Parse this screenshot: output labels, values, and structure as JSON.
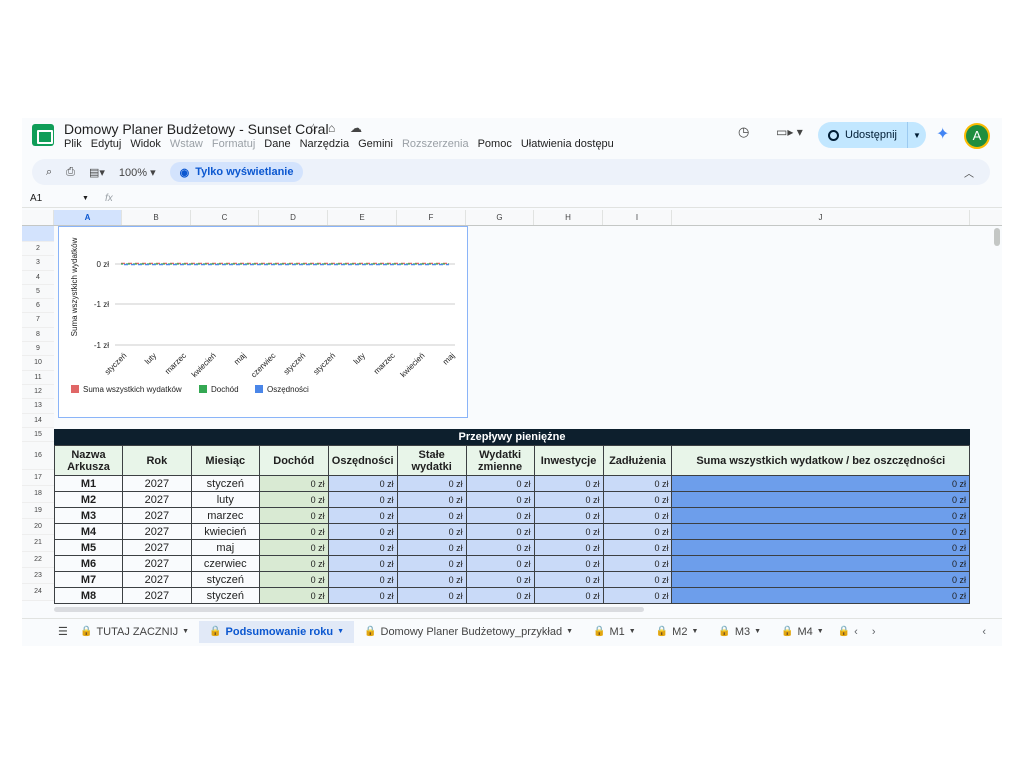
{
  "app": {
    "doc_title": "Domowy Planer Budżetowy - Sunset Coral",
    "menu": [
      {
        "label": "Plik",
        "disabled": false
      },
      {
        "label": "Edytuj",
        "disabled": false
      },
      {
        "label": "Widok",
        "disabled": false
      },
      {
        "label": "Wstaw",
        "disabled": true
      },
      {
        "label": "Formatuj",
        "disabled": true
      },
      {
        "label": "Dane",
        "disabled": false
      },
      {
        "label": "Narzędzia",
        "disabled": false
      },
      {
        "label": "Gemini",
        "disabled": false
      },
      {
        "label": "Rozszerzenia",
        "disabled": true
      },
      {
        "label": "Pomoc",
        "disabled": false
      },
      {
        "label": "Ułatwienia dostępu",
        "disabled": false
      }
    ],
    "share_label": "Udostępnij",
    "avatar_letter": "A",
    "accent": "#0b57d0"
  },
  "toolbar": {
    "zoom": "100%",
    "view_only_label": "Tylko wyświetlanie"
  },
  "formula_bar": {
    "cell_ref": "A1",
    "fx": "fx"
  },
  "grid": {
    "columns": [
      "A",
      "B",
      "C",
      "D",
      "E",
      "F",
      "G",
      "H",
      "I",
      "J"
    ],
    "rows": [
      "2",
      "3",
      "4",
      "5",
      "6",
      "7",
      "8",
      "9",
      "10",
      "11",
      "12",
      "13",
      "14",
      "15",
      "16",
      "17",
      "18",
      "19",
      "20",
      "21",
      "22",
      "23",
      "24"
    ]
  },
  "chart_data": {
    "type": "line",
    "categories": [
      "styczeń",
      "luty",
      "marzec",
      "kwiecień",
      "maj",
      "czerwiec",
      "styczeń",
      "styczeń",
      "luty",
      "marzec",
      "kwiecień",
      "maj"
    ],
    "series": [
      {
        "name": "Suma wszystkich wydatków",
        "color": "#e06666",
        "values": [
          0,
          0,
          0,
          0,
          0,
          0,
          0,
          0,
          0,
          0,
          0,
          0
        ]
      },
      {
        "name": "Dochód",
        "color": "#34a853",
        "values": [
          0,
          0,
          0,
          0,
          0,
          0,
          0,
          0,
          0,
          0,
          0,
          0
        ]
      },
      {
        "name": "Oszędności",
        "color": "#4a86e8",
        "values": [
          0,
          0,
          0,
          0,
          0,
          0,
          0,
          0,
          0,
          0,
          0,
          0
        ]
      }
    ],
    "ylabel": "Suma wszystkich wydatków",
    "y_tick_labels": [
      "0 zł",
      "-1 zł",
      "-1 zł"
    ],
    "grid": true,
    "legend": "bottom-left"
  },
  "cashflow": {
    "title": "Przepływy pieniężne",
    "headers": [
      "Nazwa Arkusza",
      "Rok",
      "Miesiąc",
      "Dochód",
      "Oszędności",
      "Stałe wydatki",
      "Wydatki zmienne",
      "Inwestycje",
      "Zadłużenia",
      "Suma wszystkich wydatkow / bez oszczędności"
    ],
    "rows": [
      {
        "sheet": "M1",
        "year": "2027",
        "month": "styczeń",
        "values": [
          "0 zł",
          "0 zł",
          "0 zł",
          "0 zł",
          "0 zł",
          "0 zł",
          "0 zł"
        ]
      },
      {
        "sheet": "M2",
        "year": "2027",
        "month": "luty",
        "values": [
          "0 zł",
          "0 zł",
          "0 zł",
          "0 zł",
          "0 zł",
          "0 zł",
          "0 zł"
        ]
      },
      {
        "sheet": "M3",
        "year": "2027",
        "month": "marzec",
        "values": [
          "0 zł",
          "0 zł",
          "0 zł",
          "0 zł",
          "0 zł",
          "0 zł",
          "0 zł"
        ]
      },
      {
        "sheet": "M4",
        "year": "2027",
        "month": "kwiecień",
        "values": [
          "0 zł",
          "0 zł",
          "0 zł",
          "0 zł",
          "0 zł",
          "0 zł",
          "0 zł"
        ]
      },
      {
        "sheet": "M5",
        "year": "2027",
        "month": "maj",
        "values": [
          "0 zł",
          "0 zł",
          "0 zł",
          "0 zł",
          "0 zł",
          "0 zł",
          "0 zł"
        ]
      },
      {
        "sheet": "M6",
        "year": "2027",
        "month": "czerwiec",
        "values": [
          "0 zł",
          "0 zł",
          "0 zł",
          "0 zł",
          "0 zł",
          "0 zł",
          "0 zł"
        ]
      },
      {
        "sheet": "M7",
        "year": "2027",
        "month": "styczeń",
        "values": [
          "0 zł",
          "0 zł",
          "0 zł",
          "0 zł",
          "0 zł",
          "0 zł",
          "0 zł"
        ]
      },
      {
        "sheet": "M8",
        "year": "2027",
        "month": "styczeń",
        "values": [
          "0 zł",
          "0 zł",
          "0 zł",
          "0 zł",
          "0 zł",
          "0 zł",
          "0 zł"
        ]
      }
    ]
  },
  "sheet_tabs": [
    {
      "label": "TUTAJ ZACZNIJ",
      "active": false
    },
    {
      "label": "Podsumowanie roku",
      "active": true
    },
    {
      "label": "Domowy Planer Budżetowy_przykład",
      "active": false
    },
    {
      "label": "M1",
      "active": false
    },
    {
      "label": "M2",
      "active": false
    },
    {
      "label": "M3",
      "active": false
    },
    {
      "label": "M4",
      "active": false
    }
  ]
}
